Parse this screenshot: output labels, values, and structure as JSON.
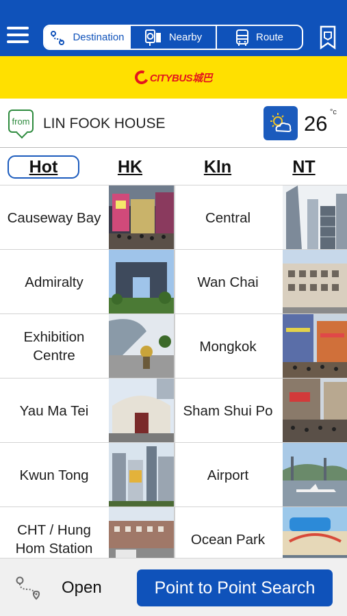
{
  "header": {
    "tabs": [
      {
        "label": "Destination",
        "icon": "destination-icon",
        "active": true
      },
      {
        "label": "Nearby",
        "icon": "nearby-icon",
        "active": false
      },
      {
        "label": "Route",
        "icon": "bus-icon",
        "active": false
      }
    ],
    "bookmark_icon": "bookmark-icon",
    "menu_icon": "hamburger-menu-icon"
  },
  "brand": {
    "logo_text": "CITYBUS城巴",
    "logo_color": "#e4161d",
    "band_color": "#ffe000"
  },
  "origin": {
    "badge": "from",
    "location": "LIN FOOK HOUSE"
  },
  "weather": {
    "icon": "partly-cloudy-icon",
    "temperature": "26",
    "unit": "°c"
  },
  "region_tabs": [
    {
      "label": "Hot",
      "active": true
    },
    {
      "label": "HK",
      "active": false
    },
    {
      "label": "Kln",
      "active": false
    },
    {
      "label": "NT",
      "active": false
    }
  ],
  "destinations": [
    {
      "left": {
        "name": "Causeway Bay"
      },
      "right": {
        "name": "Central"
      }
    },
    {
      "left": {
        "name": "Admiralty"
      },
      "right": {
        "name": "Wan Chai"
      }
    },
    {
      "left": {
        "name": "Exhibition Centre"
      },
      "right": {
        "name": "Mongkok"
      }
    },
    {
      "left": {
        "name": "Yau Ma Tei"
      },
      "right": {
        "name": "Sham Shui Po"
      }
    },
    {
      "left": {
        "name": "Kwun Tong"
      },
      "right": {
        "name": "Airport"
      }
    },
    {
      "left": {
        "name": "CHT / Hung Hom Station"
      },
      "right": {
        "name": "Ocean Park"
      }
    }
  ],
  "bottom": {
    "open_label": "Open",
    "search_label": "Point to Point Search"
  },
  "colors": {
    "primary_blue": "#0f52ba",
    "from_green": "#2e8b3e"
  }
}
